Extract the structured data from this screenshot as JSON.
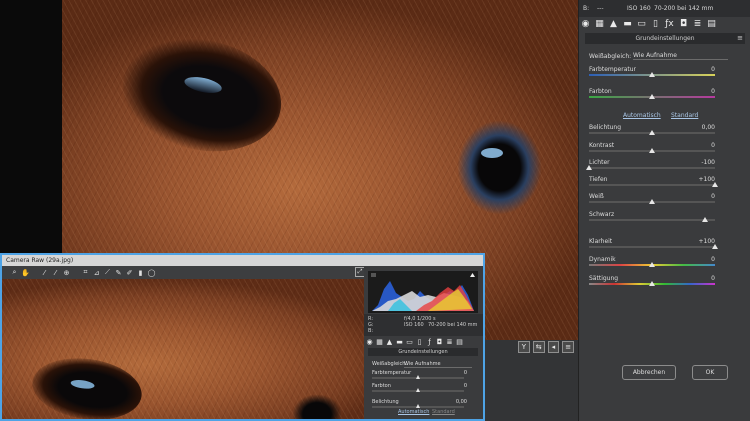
{
  "back_window": {
    "camera_info": {
      "label_b": "B:",
      "dash": "---",
      "iso": "ISO 160",
      "lens": "70-200 bei 142 mm"
    },
    "tool_icons": [
      "grundeinstellungen-icon",
      "gradationskurve-icon",
      "details-icon",
      "hsl-icon",
      "teiltonung-icon",
      "objektivkorrektur-icon",
      "effekte-icon",
      "kamerakalibrierung-icon",
      "vorgaben-icon",
      "schnappschuesse-icon"
    ],
    "section_title": "Grundeinstellungen",
    "weissabgleich": {
      "label": "Weißabgleich:",
      "value": "Wie Aufnahme"
    },
    "tabs": {
      "auto": "Automatisch",
      "standard": "Standard"
    },
    "sliders": [
      {
        "label": "Farbtemperatur",
        "value": "0",
        "pos": 0.5
      },
      {
        "label": "Farbton",
        "value": "0",
        "pos": 0.5
      },
      {
        "label": "Belichtung",
        "value": "0,00",
        "pos": 0.5
      },
      {
        "label": "Kontrast",
        "value": "0",
        "pos": 0.5
      },
      {
        "label": "Lichter",
        "value": "-100",
        "pos": 0.0
      },
      {
        "label": "Tiefen",
        "value": "+100",
        "pos": 1.0
      },
      {
        "label": "Weiß",
        "value": "0",
        "pos": 0.5
      },
      {
        "label": "Schwarz",
        "value": "",
        "pos": 0.92
      },
      {
        "label": "Klarheit",
        "value": "+100",
        "pos": 1.0
      },
      {
        "label": "Dynamik",
        "value": "0",
        "pos": 0.5
      },
      {
        "label": "Sättigung",
        "value": "0",
        "pos": 0.5
      }
    ],
    "buttons": {
      "cancel": "Abbrechen",
      "ok": "OK"
    }
  },
  "front_window": {
    "title": "Camera Raw (29a.jpg)",
    "camera_info": {
      "r": "R:",
      "g": "G:",
      "b": "B:",
      "shutter": "f/4,0  1/200 s",
      "iso": "ISO 160",
      "lens": "70-200 bei 140 mm"
    },
    "section_title": "Grundeinstellungen",
    "weissabgleich": {
      "label": "Weißabgleich:",
      "value": "Wie Aufnahme"
    },
    "tabs": {
      "auto": "Automatisch",
      "standard": "Standard"
    },
    "sliders": [
      {
        "label": "Farbtemperatur",
        "value": "0",
        "pos": 0.5
      },
      {
        "label": "Farbton",
        "value": "0",
        "pos": 0.5
      },
      {
        "label": "Belichtung",
        "value": "0,00",
        "pos": 0.5
      }
    ]
  },
  "colors": {
    "accent_blue": "#4ea3e6",
    "panel": "#3a3b3d"
  }
}
